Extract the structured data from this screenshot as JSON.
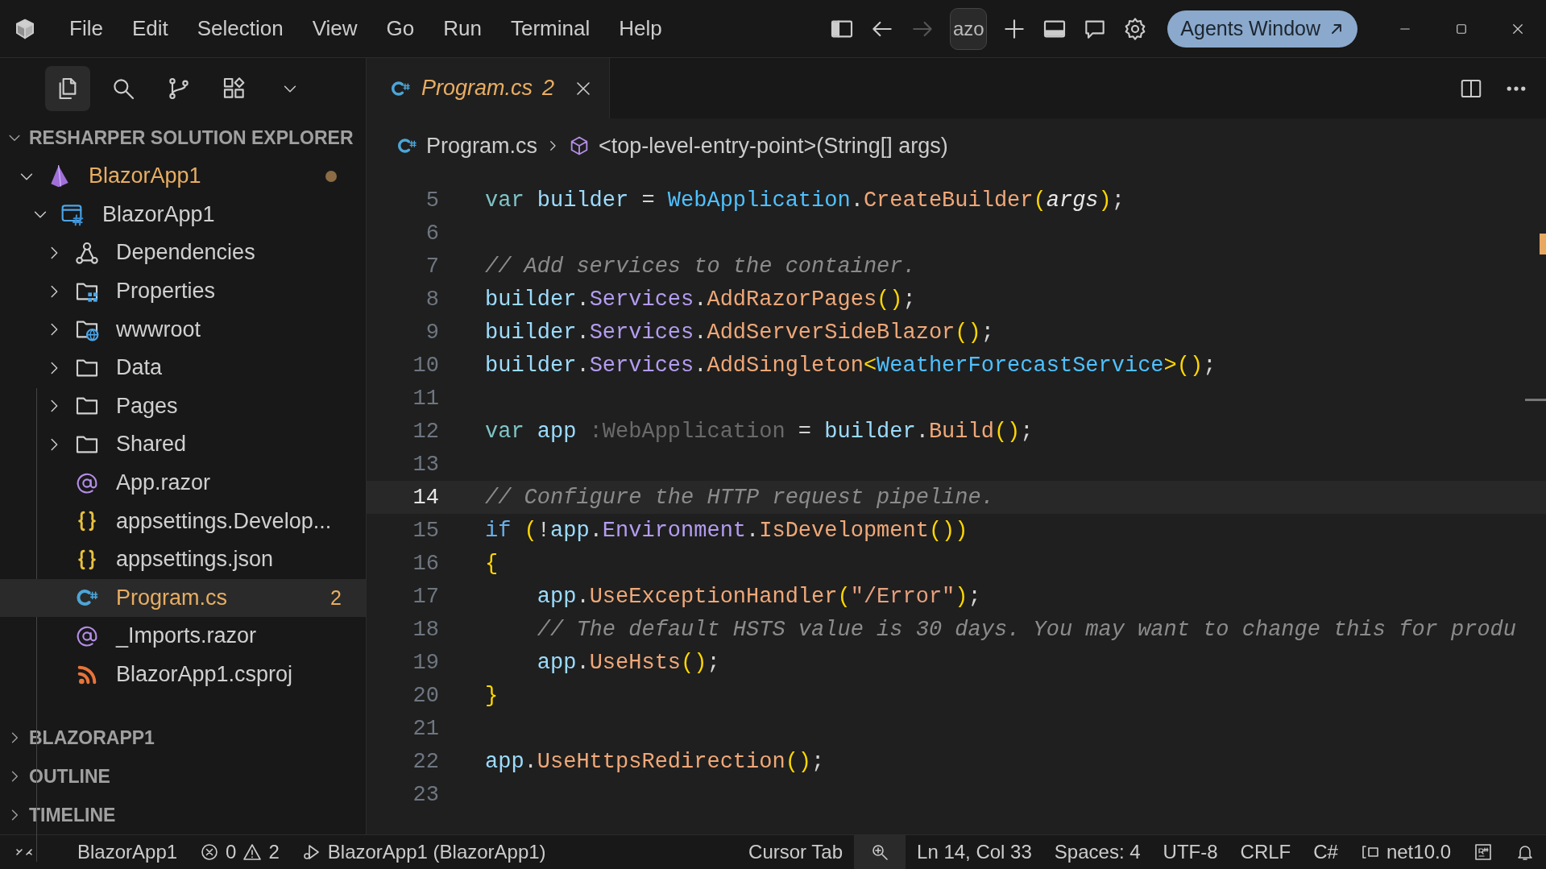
{
  "title_bar": {
    "menu": [
      "File",
      "Edit",
      "Selection",
      "View",
      "Go",
      "Run",
      "Terminal",
      "Help"
    ],
    "forward_disabled": true,
    "command_center": "azo",
    "agents_button": "Agents Window"
  },
  "activity_bar": [
    {
      "kind": "explorer",
      "selected": true
    },
    {
      "kind": "search",
      "selected": false
    },
    {
      "kind": "source-control",
      "selected": false
    },
    {
      "kind": "extensions",
      "selected": false
    }
  ],
  "tabs": [
    {
      "label": "Program.cs",
      "badge": "2",
      "preview": true,
      "selected": true
    }
  ],
  "breadcrumb": [
    {
      "kind": "file",
      "label": "Program.cs"
    },
    {
      "kind": "symbol",
      "label": "<top-level-entry-point>(String[] args)"
    }
  ],
  "sidebar": {
    "sections": [
      {
        "title": "RESHARPER SOLUTION EXPLORER",
        "expanded": true,
        "tree": [
          {
            "kind": "solution",
            "label": "BlazorApp1",
            "expanded": true,
            "selected": false,
            "warning": true,
            "color": "#8c6c45",
            "children": [
              {
                "kind": "project",
                "label": "BlazorApp1",
                "expanded": true,
                "selected": false,
                "warning": false,
                "children": [
                  {
                    "kind": "dependencies",
                    "label": "Dependencies",
                    "expanded": false,
                    "selected": false,
                    "warning": false
                  },
                  {
                    "kind": "properties",
                    "label": "Properties",
                    "expanded": false,
                    "selected": false,
                    "warning": false
                  },
                  {
                    "kind": "web-folder",
                    "label": "wwwroot",
                    "expanded": false,
                    "selected": false,
                    "warning": false
                  },
                  {
                    "kind": "folder",
                    "label": "Data",
                    "expanded": false,
                    "selected": false,
                    "warning": false
                  },
                  {
                    "kind": "folder",
                    "label": "Pages",
                    "expanded": false,
                    "selected": false,
                    "warning": false
                  },
                  {
                    "kind": "folder",
                    "label": "Shared",
                    "expanded": false,
                    "selected": false,
                    "warning": false
                  },
                  {
                    "kind": "razor",
                    "label": "App.razor",
                    "selected": false,
                    "warning": false
                  },
                  {
                    "kind": "json",
                    "label": "appsettings.Develop...",
                    "selected": false,
                    "warning": false
                  },
                  {
                    "kind": "json",
                    "label": "appsettings.json",
                    "selected": false,
                    "warning": false
                  },
                  {
                    "kind": "csharp",
                    "label": "Program.cs",
                    "selected": true,
                    "warning": true,
                    "badge": "2"
                  },
                  {
                    "kind": "razor",
                    "label": "_Imports.razor",
                    "selected": false,
                    "warning": false
                  },
                  {
                    "kind": "csproj",
                    "label": "BlazorApp1.csproj",
                    "selected": false,
                    "warning": false
                  }
                ]
              }
            ]
          }
        ]
      },
      {
        "title": "BLAZORAPP1",
        "expanded": false
      },
      {
        "title": "OUTLINE",
        "expanded": false
      },
      {
        "title": "TIMELINE",
        "expanded": false
      }
    ]
  },
  "editor": {
    "lines": [
      {
        "number": "5",
        "current": false,
        "tokens": [
          {
            "kind": "keyword",
            "text": "var"
          },
          {
            "kind": "variable",
            "text": " builder"
          },
          {
            "kind": "plain",
            "text": " = "
          },
          {
            "kind": "type",
            "text": "WebApplication"
          },
          {
            "kind": "plain",
            "text": "."
          },
          {
            "kind": "method",
            "text": "CreateBuilder"
          },
          {
            "kind": "paren",
            "text": "("
          },
          {
            "kind": "param",
            "text": "args"
          },
          {
            "kind": "paren",
            "text": ")"
          },
          {
            "kind": "plain",
            "text": ";"
          }
        ]
      },
      {
        "number": "6",
        "current": false
      },
      {
        "number": "7",
        "current": false,
        "tokens": [
          {
            "kind": "comment",
            "text": "// Add services to the container."
          }
        ]
      },
      {
        "number": "8",
        "current": false,
        "tokens": [
          {
            "kind": "variable",
            "text": "builder"
          },
          {
            "kind": "plain",
            "text": "."
          },
          {
            "kind": "property",
            "text": "Services"
          },
          {
            "kind": "plain",
            "text": "."
          },
          {
            "kind": "method",
            "text": "AddRazorPages"
          },
          {
            "kind": "paren",
            "text": "()"
          },
          {
            "kind": "plain",
            "text": ";"
          }
        ]
      },
      {
        "number": "9",
        "current": false,
        "tokens": [
          {
            "kind": "variable",
            "text": "builder"
          },
          {
            "kind": "plain",
            "text": "."
          },
          {
            "kind": "property",
            "text": "Services"
          },
          {
            "kind": "plain",
            "text": "."
          },
          {
            "kind": "method",
            "text": "AddServerSideBlazor"
          },
          {
            "kind": "paren",
            "text": "()"
          },
          {
            "kind": "plain",
            "text": ";"
          }
        ]
      },
      {
        "number": "10",
        "current": false,
        "tokens": [
          {
            "kind": "variable",
            "text": "builder"
          },
          {
            "kind": "plain",
            "text": "."
          },
          {
            "kind": "property",
            "text": "Services"
          },
          {
            "kind": "plain",
            "text": "."
          },
          {
            "kind": "method",
            "text": "AddSingleton"
          },
          {
            "kind": "paren",
            "text": "<"
          },
          {
            "kind": "type",
            "text": "WeatherForecastService"
          },
          {
            "kind": "paren",
            "text": ">()"
          },
          {
            "kind": "plain",
            "text": ";"
          }
        ]
      },
      {
        "number": "11",
        "current": false
      },
      {
        "number": "12",
        "current": false,
        "tokens": [
          {
            "kind": "keyword",
            "text": "var"
          },
          {
            "kind": "variable",
            "text": " app"
          },
          {
            "kind": "inlay",
            "text": " :WebApplication"
          },
          {
            "kind": "plain",
            "text": " = "
          },
          {
            "kind": "variable",
            "text": "builder"
          },
          {
            "kind": "plain",
            "text": "."
          },
          {
            "kind": "method",
            "text": "Build"
          },
          {
            "kind": "paren",
            "text": "()"
          },
          {
            "kind": "plain",
            "text": ";"
          }
        ]
      },
      {
        "number": "13",
        "current": false
      },
      {
        "number": "14",
        "current": true,
        "tokens": [
          {
            "kind": "comment",
            "text": "// Configure the HTTP request pipeline."
          }
        ]
      },
      {
        "number": "15",
        "current": false,
        "tokens": [
          {
            "kind": "control",
            "text": "if"
          },
          {
            "kind": "paren",
            "text": " ("
          },
          {
            "kind": "plain",
            "text": "!"
          },
          {
            "kind": "variable",
            "text": "app"
          },
          {
            "kind": "plain",
            "text": "."
          },
          {
            "kind": "property",
            "text": "Environment"
          },
          {
            "kind": "plain",
            "text": "."
          },
          {
            "kind": "method",
            "text": "IsDevelopment"
          },
          {
            "kind": "paren",
            "text": "())"
          }
        ]
      },
      {
        "number": "16",
        "current": false,
        "tokens": [
          {
            "kind": "paren",
            "text": "{"
          }
        ]
      },
      {
        "number": "17",
        "current": false,
        "tokens": [
          {
            "kind": "variable",
            "text": "    app"
          },
          {
            "kind": "plain",
            "text": "."
          },
          {
            "kind": "method",
            "text": "UseExceptionHandler"
          },
          {
            "kind": "paren",
            "text": "("
          },
          {
            "kind": "string",
            "text": "\"/Error\""
          },
          {
            "kind": "paren",
            "text": ")"
          },
          {
            "kind": "plain",
            "text": ";"
          }
        ]
      },
      {
        "number": "18",
        "current": false,
        "tokens": [
          {
            "kind": "comment",
            "text": "    // The default HSTS value is 30 days. You may want to change this for produ"
          }
        ]
      },
      {
        "number": "19",
        "current": false,
        "tokens": [
          {
            "kind": "variable",
            "text": "    app"
          },
          {
            "kind": "plain",
            "text": "."
          },
          {
            "kind": "method",
            "text": "UseHsts"
          },
          {
            "kind": "paren",
            "text": "()"
          },
          {
            "kind": "plain",
            "text": ";"
          }
        ]
      },
      {
        "number": "20",
        "current": false,
        "tokens": [
          {
            "kind": "paren",
            "text": "}"
          }
        ]
      },
      {
        "number": "21",
        "current": false
      },
      {
        "number": "22",
        "current": false,
        "tokens": [
          {
            "kind": "variable",
            "text": "app"
          },
          {
            "kind": "plain",
            "text": "."
          },
          {
            "kind": "method",
            "text": "UseHttpsRedirection"
          },
          {
            "kind": "paren",
            "text": "()"
          },
          {
            "kind": "plain",
            "text": ";"
          }
        ]
      },
      {
        "number": "23",
        "current": false
      }
    ]
  },
  "status_bar": [
    {
      "kind": "remote"
    },
    {
      "kind": "text",
      "text": "BlazorApp1"
    },
    {
      "kind": "problems",
      "errors": "0",
      "warnings": "2"
    },
    {
      "kind": "debug",
      "text": "BlazorApp1 (BlazorApp1)"
    },
    {
      "kind": "text",
      "text": "Cursor Tab"
    },
    {
      "kind": "zoom"
    },
    {
      "kind": "text",
      "text": "Ln 14, Col 33"
    },
    {
      "kind": "text",
      "text": "Spaces: 4"
    },
    {
      "kind": "text",
      "text": "UTF-8"
    },
    {
      "kind": "text",
      "text": "CRLF"
    },
    {
      "kind": "text",
      "text": "C#"
    },
    {
      "kind": "framework",
      "text": "net10.0"
    },
    {
      "kind": "resharper"
    },
    {
      "kind": "bell"
    }
  ]
}
